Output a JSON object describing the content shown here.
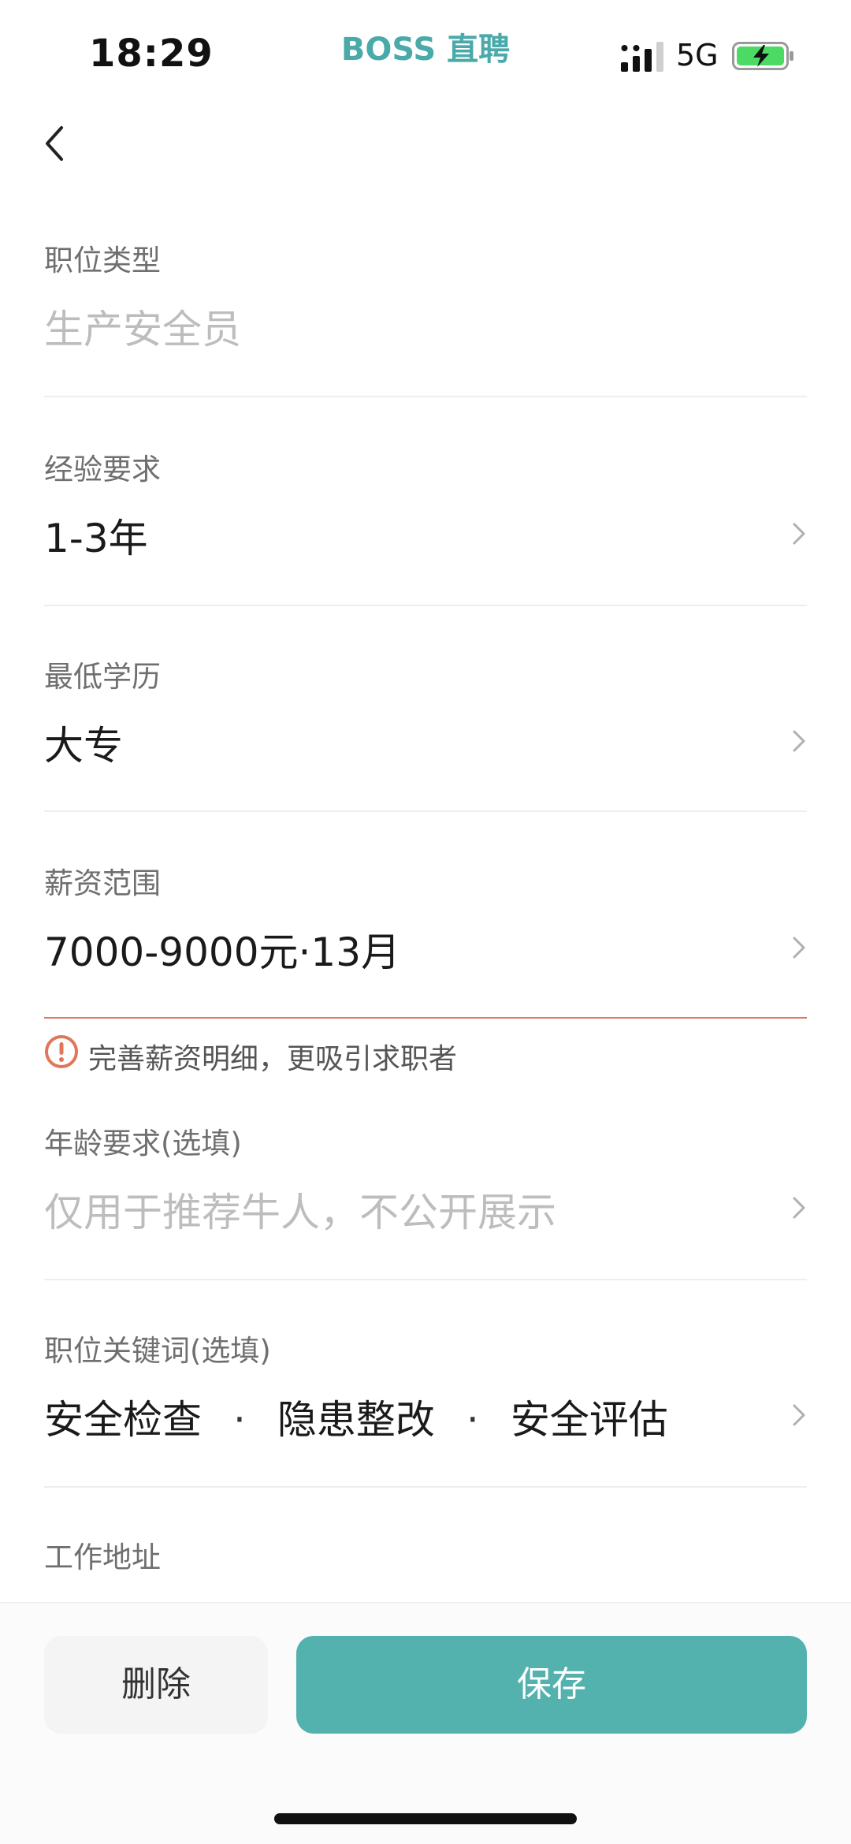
{
  "status_bar": {
    "time": "18:29",
    "app_name": "BOSS 直聘",
    "network": "5G",
    "battery_charging": true,
    "battery_color": "#4cd964"
  },
  "fields": {
    "job_type": {
      "label": "职位类型",
      "value": "生产安全员"
    },
    "experience": {
      "label": "经验要求",
      "value": "1-3年"
    },
    "education": {
      "label": "最低学历",
      "value": "大专"
    },
    "salary": {
      "label": "薪资范围",
      "value": "7000-9000元·13月"
    },
    "salary_hint": "完善薪资明细，更吸引求职者",
    "age": {
      "label": "年龄要求(选填)",
      "placeholder": "仅用于推荐牛人，不公开展示"
    },
    "keywords": {
      "label": "职位关键词(选填)",
      "items": [
        "安全检查",
        "隐患整改",
        "安全评估"
      ],
      "separator": "·"
    },
    "address": {
      "label": "工作地址"
    }
  },
  "actions": {
    "delete_label": "删除",
    "save_label": "保存"
  },
  "colors": {
    "accent": "#54b2ae",
    "error": "#e2765a",
    "brand": "#4aa9a9"
  }
}
